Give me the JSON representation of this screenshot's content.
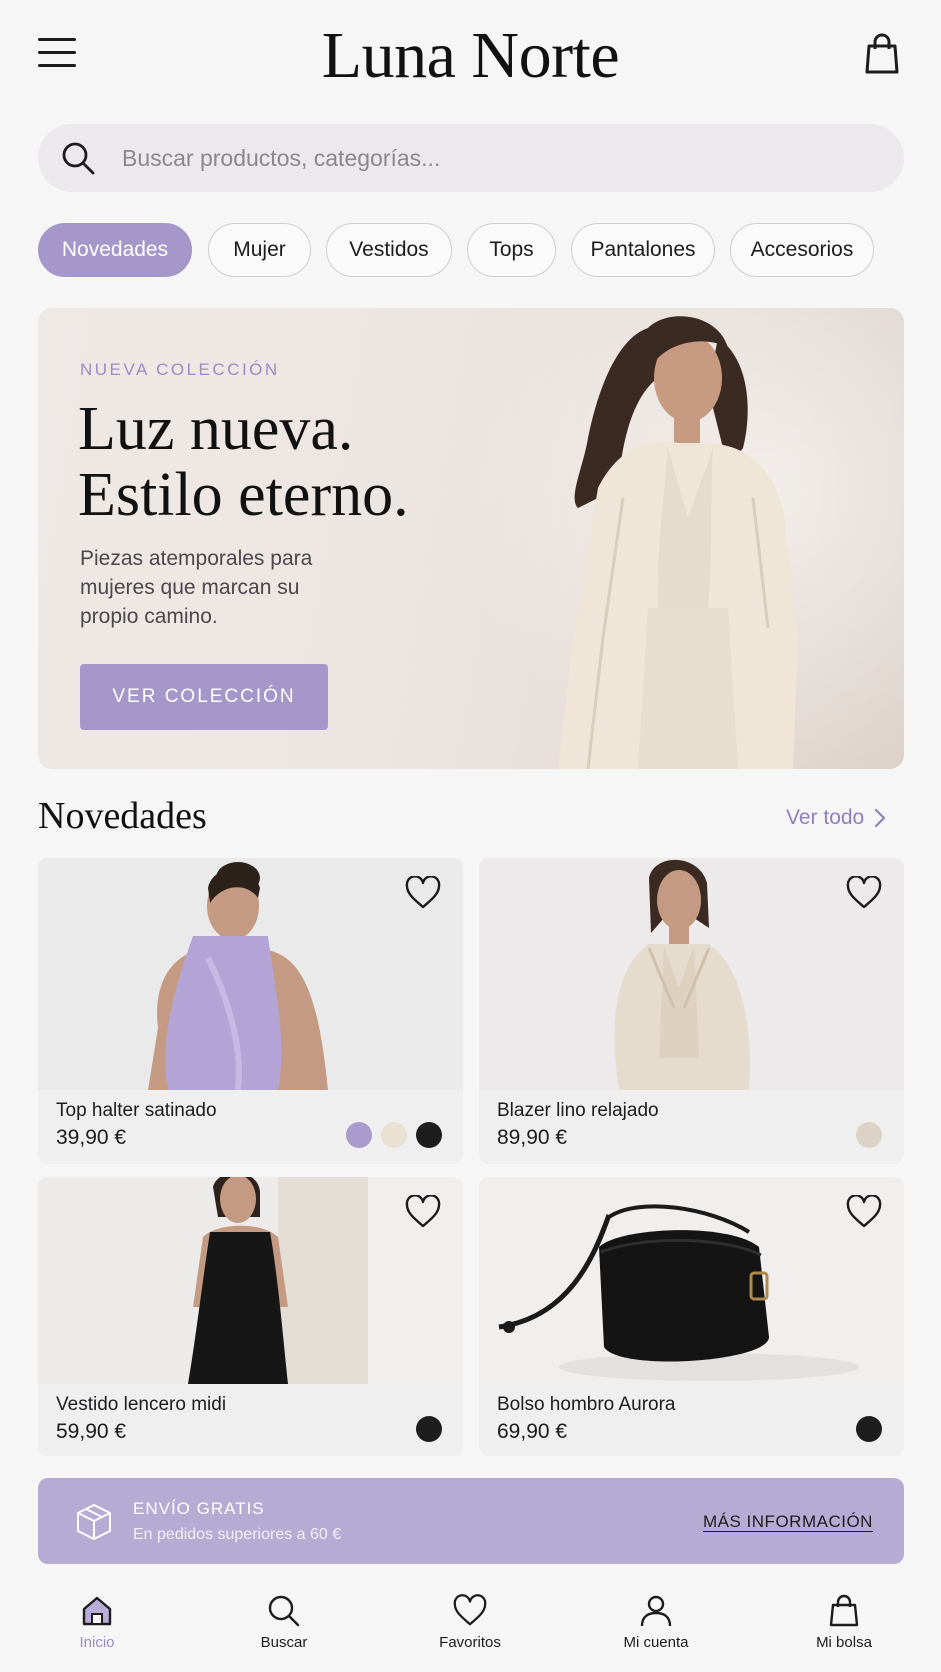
{
  "header": {
    "brand": "Luna Norte",
    "menu_icon": "hamburger-menu-icon",
    "bag_icon": "shopping-bag-icon"
  },
  "search": {
    "placeholder": "Buscar productos, categorías...",
    "value": "",
    "icon": "search-icon"
  },
  "categories": {
    "items": [
      {
        "label": "Novedades",
        "active": true
      },
      {
        "label": "Mujer",
        "active": false
      },
      {
        "label": "Vestidos",
        "active": false
      },
      {
        "label": "Tops",
        "active": false
      },
      {
        "label": "Pantalones",
        "active": false
      },
      {
        "label": "Accesorios",
        "active": false
      }
    ]
  },
  "hero": {
    "eyebrow": "NUEVA COLECCIÓN",
    "headline_1": "Luz nueva.",
    "headline_2": "Estilo eterno.",
    "subtitle": "Piezas atemporales para mujeres que marcan su propio camino.",
    "cta": "VER COLECCIÓN"
  },
  "section": {
    "title": "Novedades",
    "see_all": "Ver todo"
  },
  "products": [
    {
      "name": "Top halter satinado",
      "price": "39,90 €",
      "swatches": [
        "#a99bcb",
        "#e9e2d3",
        "#1d1d1d"
      ]
    },
    {
      "name": "Blazer lino relajado",
      "price": "89,90 €",
      "swatches": [
        "#dcd3c6"
      ]
    },
    {
      "name": "Vestido lencero midi",
      "price": "59,90 €",
      "swatches": [
        "#1d1d1d"
      ]
    },
    {
      "name": "Bolso hombro Aurora",
      "price": "69,90 €",
      "swatches": [
        "#1d1d1d"
      ]
    }
  ],
  "shipping": {
    "title": "ENVÍO GRATIS",
    "subtitle": "En pedidos superiores a 60 €",
    "link": "MÁS INFORMACIÓN"
  },
  "nav": {
    "items": [
      {
        "label": "Inicio",
        "icon": "home-icon",
        "active": true
      },
      {
        "label": "Buscar",
        "icon": "search-icon",
        "active": false
      },
      {
        "label": "Favoritos",
        "icon": "heart-icon",
        "active": false
      },
      {
        "label": "Mi cuenta",
        "icon": "user-icon",
        "active": false
      },
      {
        "label": "Mi bolsa",
        "icon": "shopping-bag-icon",
        "active": false
      }
    ]
  },
  "colors": {
    "accent": "#a597c9",
    "accent_text": "#9b8cc2",
    "banner": "#b6abd3",
    "background": "#f7f6f7"
  }
}
